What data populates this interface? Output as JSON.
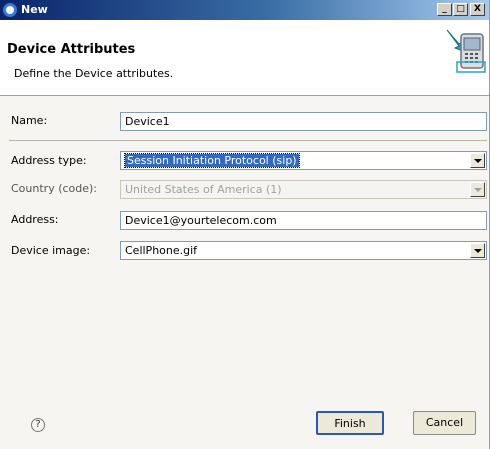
{
  "window": {
    "title": "New",
    "minimize": "_",
    "maximize": "□",
    "close": "X"
  },
  "header": {
    "title": "Device Attributes",
    "description": "Define the Device attributes."
  },
  "form": {
    "name": {
      "label": "Name:",
      "value": "Device1"
    },
    "address_type": {
      "label": "Address type:",
      "value": "Session Initiation Protocol (sip)"
    },
    "country": {
      "label": "Country (code):",
      "value": "United States of America (1)",
      "disabled": true
    },
    "address": {
      "label": "Address:",
      "value": "Device1@yourtelecom.com"
    },
    "device_image": {
      "label": "Device image:",
      "value": "CellPhone.gif"
    }
  },
  "buttons": {
    "help": "?",
    "finish": "Finish",
    "cancel": "Cancel"
  },
  "icons": {
    "app": "eclipse-icon",
    "banner": "phone-device-wizard-icon"
  },
  "colors": {
    "titlebar": "#0a246a",
    "selection": "#316ac5"
  }
}
